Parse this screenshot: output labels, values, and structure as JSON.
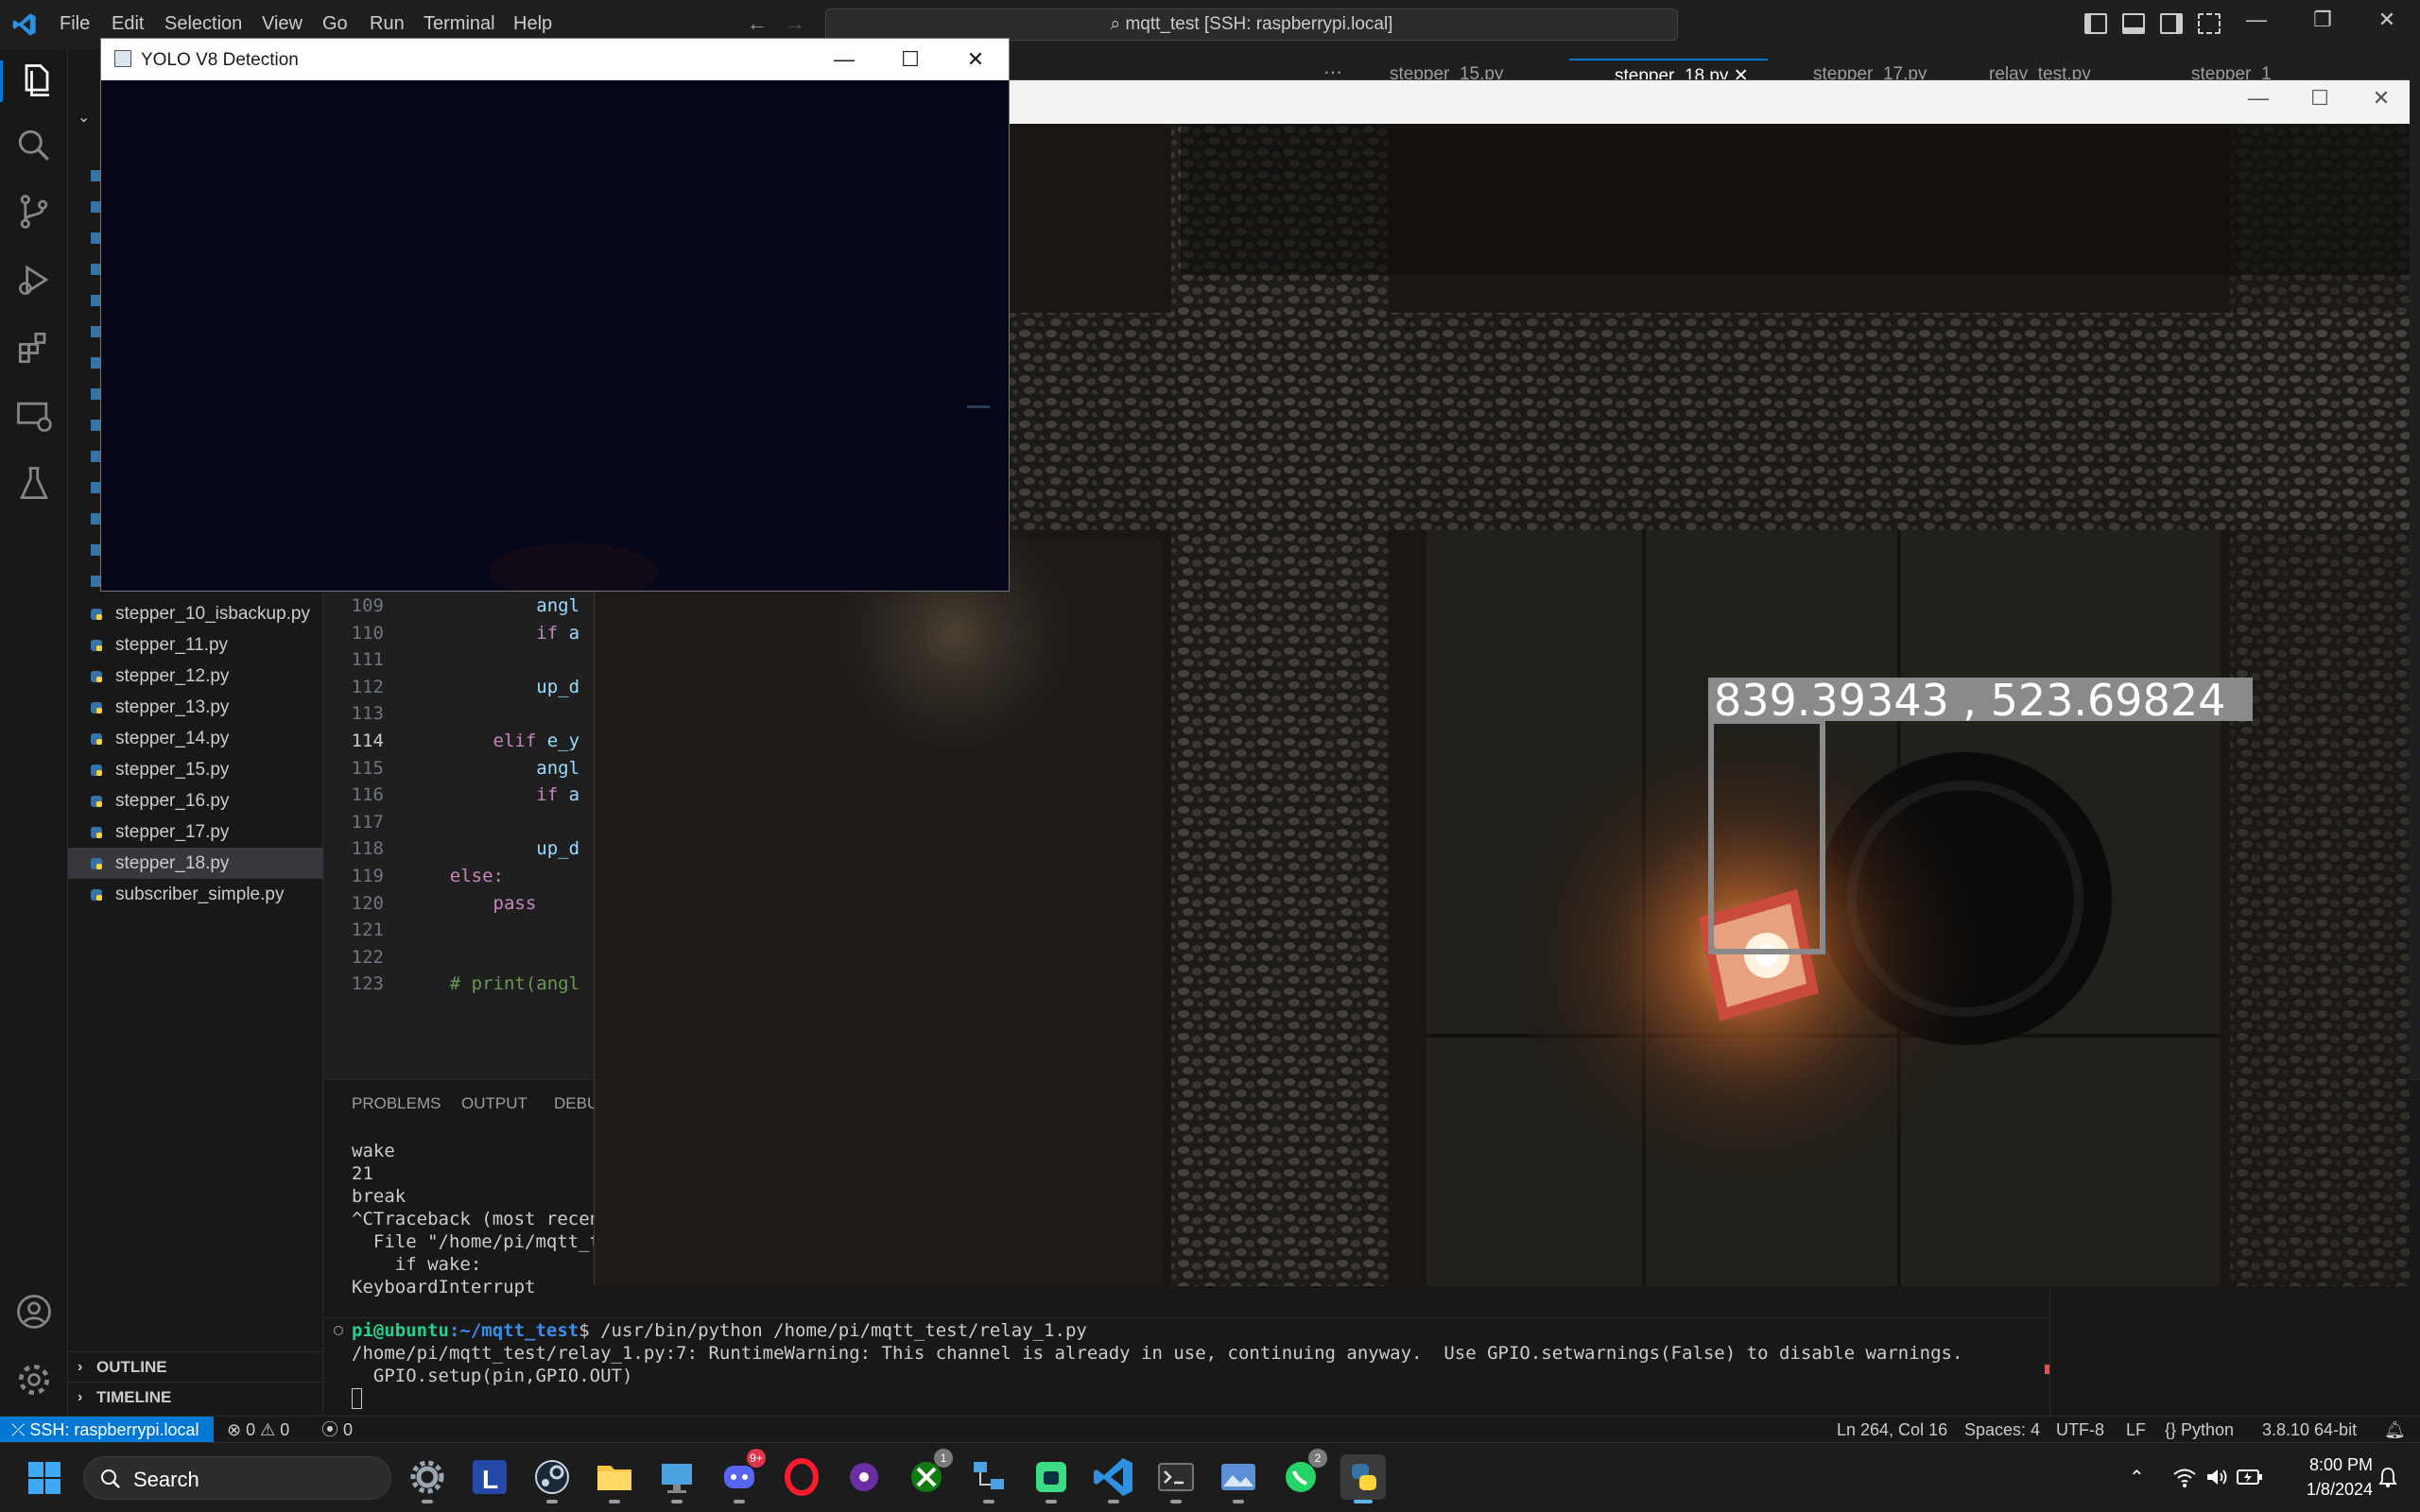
{
  "titlebar": {
    "menus": [
      "File",
      "Edit",
      "Selection",
      "View",
      "Go",
      "Run",
      "Terminal",
      "Help"
    ],
    "command_center": "mqtt_test [SSH: raspberrypi.local]"
  },
  "tabs": [
    "stepper_15.py",
    "stepper_18.py",
    "stepper_17.py",
    "relay_test.py",
    "stepper_1"
  ],
  "active_tab": "stepper_18.py",
  "explorer": {
    "files": [
      "stepper_10_isbackup.py",
      "stepper_11.py",
      "stepper_12.py",
      "stepper_13.py",
      "stepper_14.py",
      "stepper_15.py",
      "stepper_16.py",
      "stepper_17.py",
      "stepper_18.py",
      "subscriber_simple.py"
    ],
    "selected": "stepper_18.py",
    "sections": [
      "OUTLINE",
      "TIMELINE"
    ]
  },
  "editor": {
    "lines": [
      {
        "num": "109",
        "indent": "            ",
        "parts": [
          {
            "t": "angl",
            "c": "id"
          }
        ]
      },
      {
        "num": "110",
        "indent": "            ",
        "parts": [
          {
            "t": "if",
            "c": "kw"
          },
          {
            "t": " a",
            "c": "id"
          }
        ]
      },
      {
        "num": "111",
        "indent": "",
        "parts": []
      },
      {
        "num": "112",
        "indent": "            ",
        "parts": [
          {
            "t": "up_d",
            "c": "id"
          }
        ]
      },
      {
        "num": "113",
        "indent": "",
        "parts": []
      },
      {
        "num": "114",
        "indent": "        ",
        "parts": [
          {
            "t": "elif",
            "c": "kw"
          },
          {
            "t": " e_y",
            "c": "id"
          }
        ]
      },
      {
        "num": "115",
        "indent": "            ",
        "parts": [
          {
            "t": "angl",
            "c": "id"
          }
        ]
      },
      {
        "num": "116",
        "indent": "            ",
        "parts": [
          {
            "t": "if",
            "c": "kw"
          },
          {
            "t": " a",
            "c": "id"
          }
        ]
      },
      {
        "num": "117",
        "indent": "",
        "parts": []
      },
      {
        "num": "118",
        "indent": "            ",
        "parts": [
          {
            "t": "up_d",
            "c": "id"
          }
        ]
      },
      {
        "num": "119",
        "indent": "    ",
        "parts": [
          {
            "t": "else:",
            "c": "kw"
          }
        ]
      },
      {
        "num": "120",
        "indent": "        ",
        "parts": [
          {
            "t": "pass",
            "c": "kw"
          }
        ]
      },
      {
        "num": "121",
        "indent": "",
        "parts": []
      },
      {
        "num": "122",
        "indent": "",
        "parts": []
      },
      {
        "num": "123",
        "indent": "    ",
        "parts": [
          {
            "t": "# print(angl",
            "c": "cm"
          }
        ]
      }
    ],
    "current_line": "114"
  },
  "panel": {
    "tabs": [
      "PROBLEMS",
      "OUTPUT",
      "DEBU"
    ],
    "output_lines": [
      "wake",
      "21",
      "break",
      "^CTraceback (most recent",
      "  File \"/home/pi/mqtt_te",
      "    if wake:",
      "KeyboardInterrupt"
    ],
    "terminal": {
      "prompt_user": "pi@ubuntu",
      "prompt_path": ":~/mqtt_test",
      "command": "$ /usr/bin/python /home/pi/mqtt_test/relay_1.py",
      "lines": [
        "/home/pi/mqtt_test/relay_1.py:7: RuntimeWarning: This channel is already in use, continuing anyway.  Use GPIO.setwarnings(False) to disable warnings.",
        "  GPIO.setup(pin,GPIO.OUT)"
      ]
    }
  },
  "statusbar": {
    "remote": "SSH: raspberrypi.local",
    "errors": "0",
    "warnings": "0",
    "ports": "0",
    "position": "Ln 264, Col 16",
    "spaces": "Spaces: 4",
    "encoding": "UTF-8",
    "eol": "LF",
    "language": "Python",
    "interpreter": "3.8.10 64-bit"
  },
  "yolo_window": {
    "title": "YOLO V8 Detection"
  },
  "camera_window": {
    "detection_label": "839.39343 , 523.69824"
  },
  "taskbar": {
    "search_label": "Search",
    "time": "8:00 PM",
    "date": "1/8/2024",
    "badges": {
      "discord": "9+",
      "xbox": "1",
      "whatsapp": "2"
    }
  },
  "colors": {
    "accent": "#0078d4",
    "editor_bg": "#1f1f1f",
    "sidebar_bg": "#181818",
    "keyword": "#c586c0",
    "identifier": "#9cdcfe",
    "comment": "#6a9955",
    "prompt_user": "#23d18b"
  }
}
